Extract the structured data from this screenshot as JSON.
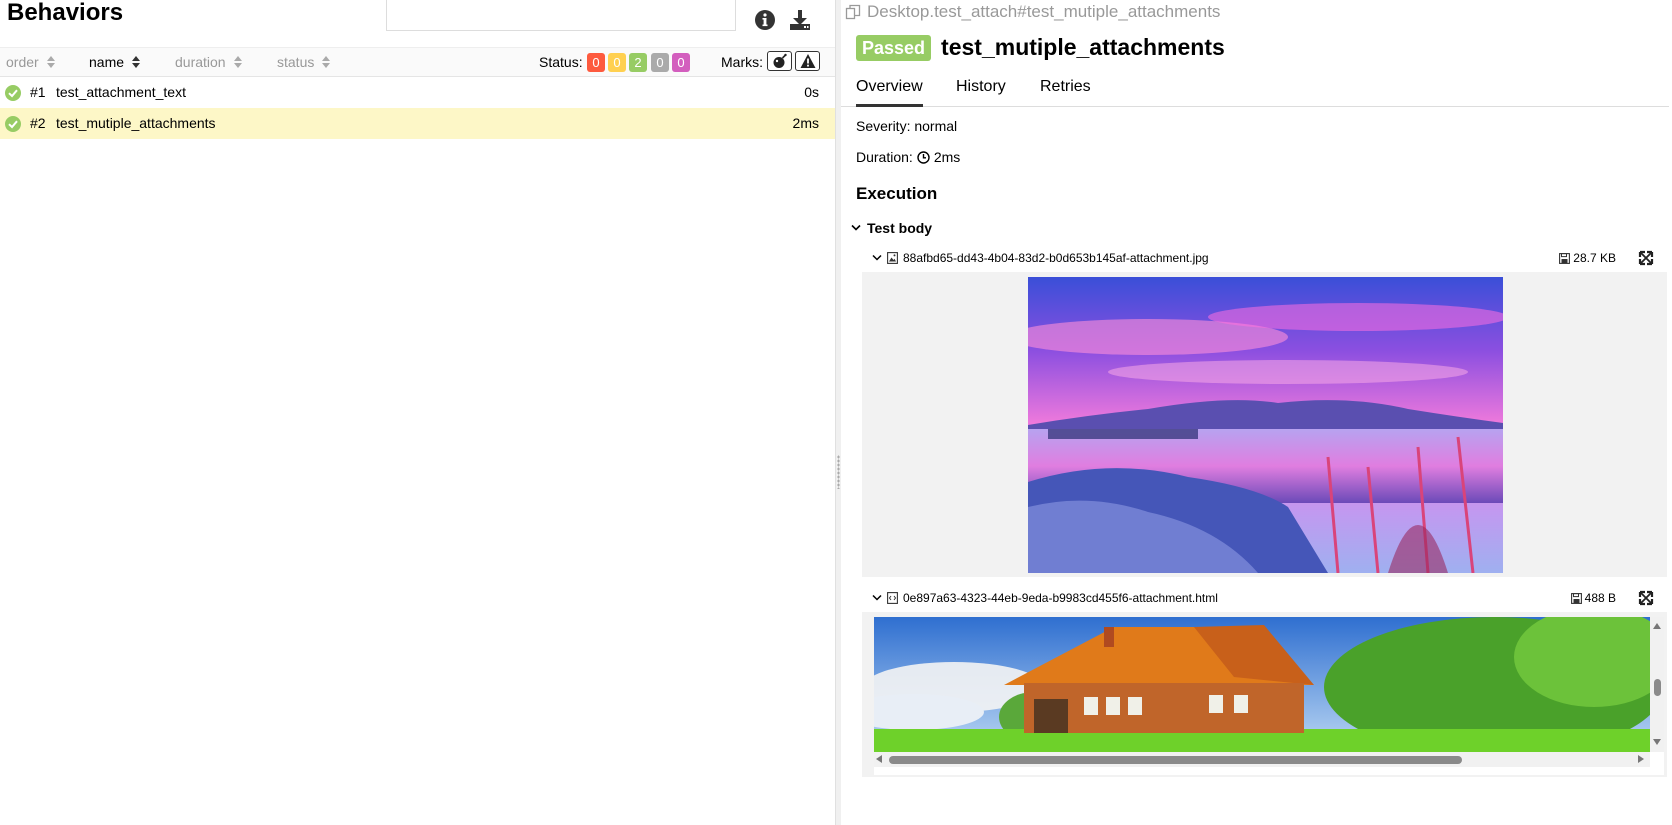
{
  "left": {
    "title": "Behaviors",
    "search": {
      "value": "",
      "placeholder": ""
    },
    "sort_columns": [
      {
        "label": "order",
        "active": false
      },
      {
        "label": "name",
        "active": true
      },
      {
        "label": "duration",
        "active": false
      },
      {
        "label": "status",
        "active": false
      }
    ],
    "status_label": "Status:",
    "status_badges": [
      {
        "name": "failed",
        "count": "0",
        "color": "#fd5a3e"
      },
      {
        "name": "broken",
        "count": "0",
        "color": "#ffd050"
      },
      {
        "name": "passed",
        "count": "2",
        "color": "#97cc64"
      },
      {
        "name": "skipped",
        "count": "0",
        "color": "#aaaaaa"
      },
      {
        "name": "unknown",
        "count": "0",
        "color": "#d35ebe"
      }
    ],
    "marks_label": "Marks:",
    "marks": [
      "flaky-icon",
      "warning-icon"
    ],
    "tests": [
      {
        "number": "#1",
        "name": "test_attachment_text",
        "duration": "0s",
        "selected": false
      },
      {
        "number": "#2",
        "name": "test_mutiple_attachments",
        "duration": "2ms",
        "selected": true
      }
    ]
  },
  "right": {
    "breadcrumb": "Desktop.test_attach#test_mutiple_attachments",
    "status": "Passed",
    "status_color": "#97cc64",
    "title": "test_mutiple_attachments",
    "tabs": [
      "Overview",
      "History",
      "Retries"
    ],
    "active_tab": "Overview",
    "severity": "Severity: normal",
    "duration_label": "Duration:",
    "duration_value": "2ms",
    "execution_title": "Execution",
    "step_title": "Test body",
    "attachments": [
      {
        "filename": "88afbd65-dd43-4b04-83d2-b0d653b145af-attachment.jpg",
        "size": "28.7 KB",
        "type": "image"
      },
      {
        "filename": "0e897a63-4323-44eb-9eda-b9983cd455f6-attachment.html",
        "size": "488 B",
        "type": "html"
      }
    ]
  }
}
